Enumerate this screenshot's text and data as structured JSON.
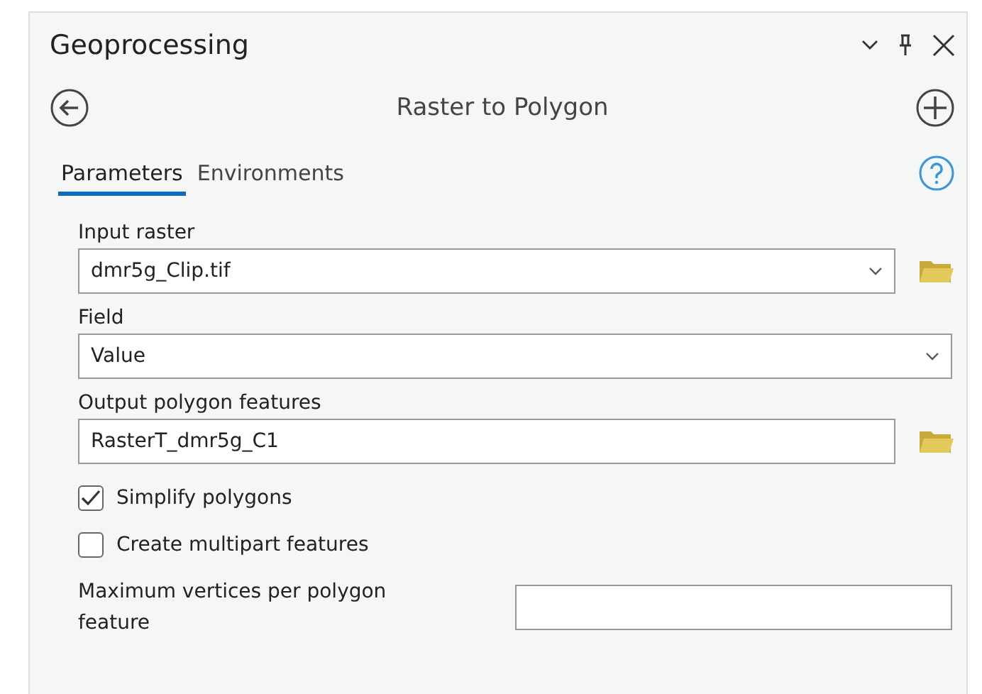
{
  "pane": {
    "title": "Geoprocessing"
  },
  "tool": {
    "title": "Raster to Polygon"
  },
  "tabs": [
    {
      "label": "Parameters",
      "selected": true
    },
    {
      "label": "Environments",
      "selected": false
    }
  ],
  "parameters": [
    {
      "kind": "dropdown",
      "label": "Input raster",
      "value": "dmr5g_Clip.tif",
      "browse": true
    },
    {
      "kind": "dropdown",
      "label": "Field",
      "value": "Value",
      "browse": false
    },
    {
      "kind": "text",
      "label": "Output polygon features",
      "value": "RasterT_dmr5g_C1",
      "browse": true
    },
    {
      "kind": "checkbox",
      "label": "Simplify polygons",
      "checked": true
    },
    {
      "kind": "checkbox",
      "label": "Create multipart features",
      "checked": false
    },
    {
      "kind": "inline",
      "label": "Maximum vertices per polygon feature"
    }
  ]
}
